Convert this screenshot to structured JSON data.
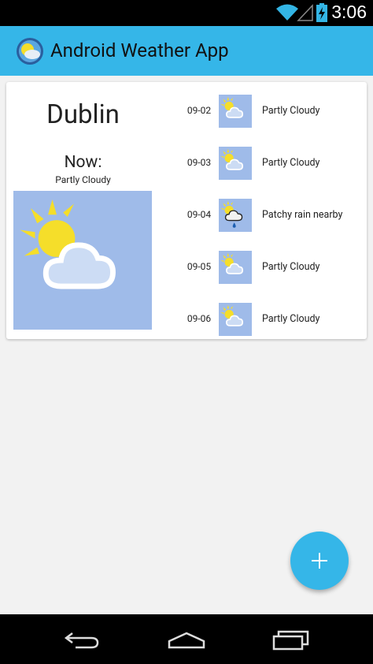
{
  "status_bar": {
    "time": "3:06",
    "icons": [
      "wifi-icon",
      "signal-icon",
      "battery-charging-icon"
    ]
  },
  "action_bar": {
    "title": "Android Weather App",
    "logo_icon": "weather-app-logo-icon"
  },
  "current": {
    "city": "Dublin",
    "now_label": "Now:",
    "condition": "Partly Cloudy",
    "icon": "partly-cloudy-icon"
  },
  "forecast": [
    {
      "date": "09-02",
      "condition": "Partly Cloudy",
      "icon": "partly-cloudy-icon"
    },
    {
      "date": "09-03",
      "condition": "Partly Cloudy",
      "icon": "partly-cloudy-icon"
    },
    {
      "date": "09-04",
      "condition": "Patchy rain nearby",
      "icon": "patchy-rain-icon"
    },
    {
      "date": "09-05",
      "condition": "Partly Cloudy",
      "icon": "partly-cloudy-icon"
    },
    {
      "date": "09-06",
      "condition": "Partly Cloudy",
      "icon": "partly-cloudy-icon"
    }
  ],
  "fab": {
    "icon": "plus-icon"
  },
  "nav_bar": {
    "buttons": [
      "back-icon",
      "home-icon",
      "recent-apps-icon"
    ]
  },
  "colors": {
    "accent": "#35b6e8",
    "icon_background": "#9fbbe9",
    "sun": "#f5de2a"
  }
}
